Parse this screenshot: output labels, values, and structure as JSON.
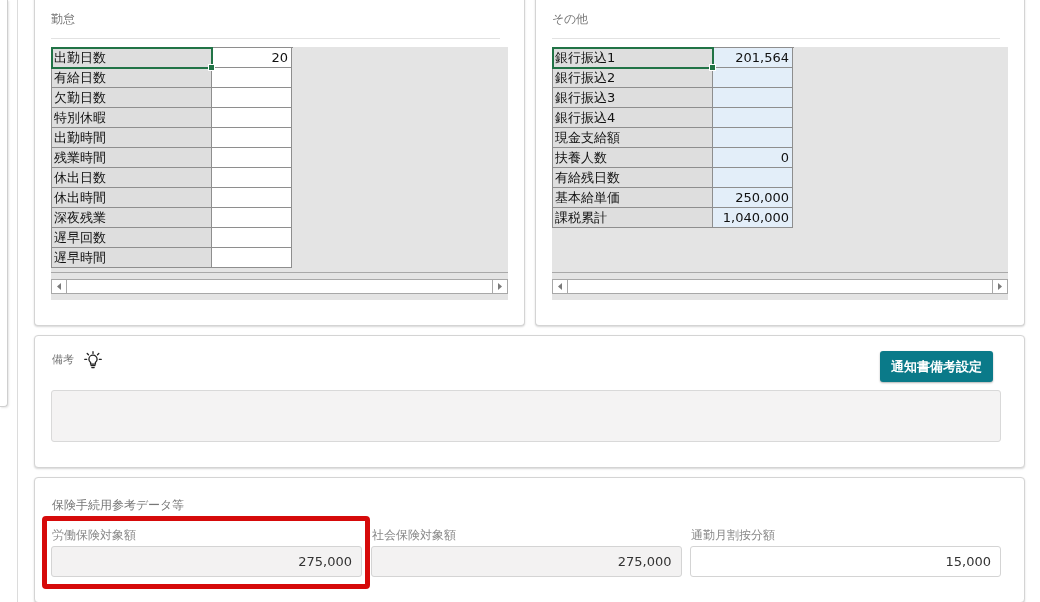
{
  "panels": [
    {
      "kind": "plain",
      "title": "勤怠",
      "rows": [
        {
          "label": "出勤日数",
          "value": "20",
          "selected": true
        },
        {
          "label": "有給日数",
          "selected": false
        },
        {
          "label": "欠勤日数",
          "selected": false
        },
        {
          "label": "特別休暇",
          "selected": false
        },
        {
          "label": "出勤時間",
          "selected": false
        },
        {
          "label": "残業時間",
          "selected": false
        },
        {
          "label": "休出日数",
          "selected": false
        },
        {
          "label": "休出時間",
          "selected": false
        },
        {
          "label": "深夜残業",
          "selected": false
        },
        {
          "label": "遅早回数",
          "selected": false
        },
        {
          "label": "遅早時間",
          "selected": false
        }
      ]
    },
    {
      "kind": "shaded",
      "title": "その他",
      "rows": [
        {
          "label": "銀行振込1",
          "value": "201,564",
          "selected": true
        },
        {
          "label": "銀行振込2",
          "selected": false
        },
        {
          "label": "銀行振込3",
          "selected": false
        },
        {
          "label": "銀行振込4",
          "selected": false
        },
        {
          "label": "現金支給額",
          "selected": false
        },
        {
          "label": "扶養人数",
          "value": "0",
          "selected": false
        },
        {
          "label": "有給残日数",
          "selected": false
        },
        {
          "label": "基本給単価",
          "value": "250,000",
          "selected": false
        },
        {
          "label": "課税累計",
          "value": "1,040,000",
          "selected": false
        }
      ]
    }
  ],
  "remarks": {
    "title": "備考",
    "button": "通知書備考設定"
  },
  "insurance": {
    "title": "保険手続用参考データ等",
    "fields": [
      {
        "label": "労働保険対象額",
        "value": "275,000",
        "readonly": true,
        "highlighted": true
      },
      {
        "label": "社会保険対象額",
        "value": "275,000",
        "readonly": true,
        "highlighted": false
      },
      {
        "label": "通勤月割按分額",
        "value": "15,000",
        "readonly": false,
        "highlighted": false
      }
    ]
  }
}
